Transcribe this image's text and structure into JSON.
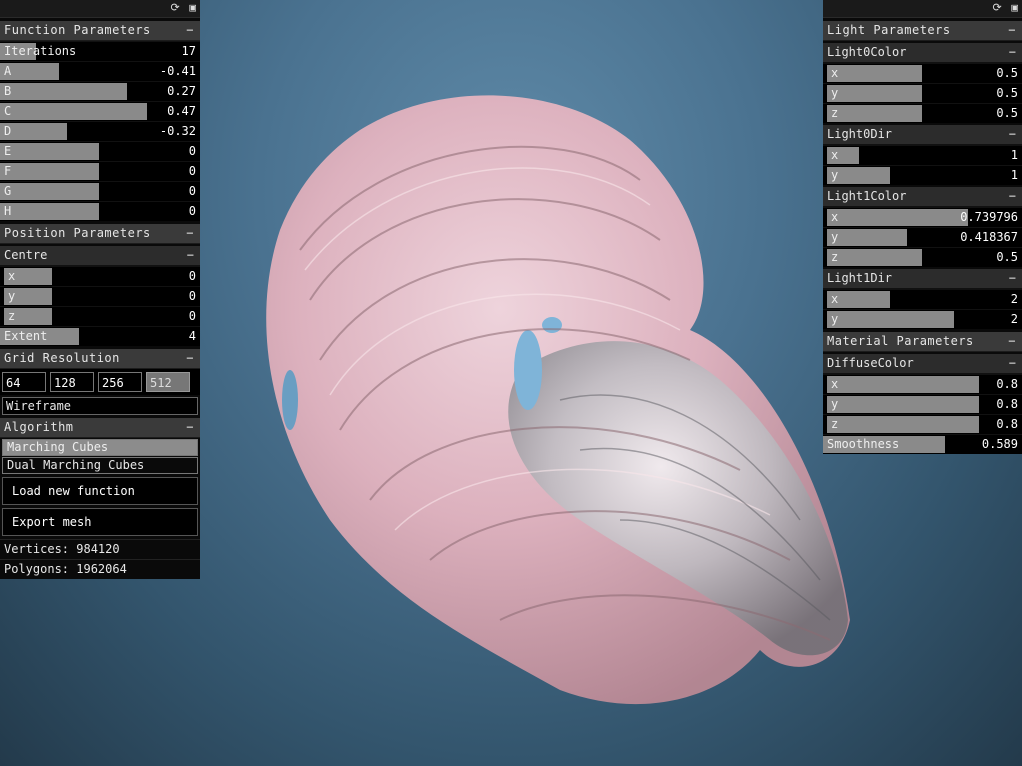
{
  "left_panel": {
    "function_params": {
      "title": "Function Parameters",
      "toggle": "−",
      "rows": [
        {
          "label": "Iterations",
          "value": "17",
          "fill": 0.18
        },
        {
          "label": "A",
          "value": "-0.41",
          "fill": 0.3
        },
        {
          "label": "B",
          "value": "0.27",
          "fill": 0.64
        },
        {
          "label": "C",
          "value": "0.47",
          "fill": 0.74
        },
        {
          "label": "D",
          "value": "-0.32",
          "fill": 0.34
        },
        {
          "label": "E",
          "value": "0",
          "fill": 0.5
        },
        {
          "label": "F",
          "value": "0",
          "fill": 0.5
        },
        {
          "label": "G",
          "value": "0",
          "fill": 0.5
        },
        {
          "label": "H",
          "value": "0",
          "fill": 0.5
        }
      ]
    },
    "position_params": {
      "title": "Position Parameters",
      "toggle": "−",
      "centre": {
        "title": "Centre",
        "toggle": "−",
        "rows": [
          {
            "label": "x",
            "value": "0",
            "fill": 0.5
          },
          {
            "label": "y",
            "value": "0",
            "fill": 0.5
          },
          {
            "label": "z",
            "value": "0",
            "fill": 0.5
          }
        ]
      },
      "extent": {
        "label": "Extent",
        "value": "4",
        "fill": 0.4
      }
    },
    "grid": {
      "title": "Grid Resolution",
      "toggle": "−",
      "options": [
        "64",
        "128",
        "256",
        "512"
      ],
      "selected": "512",
      "wireframe_label": "Wireframe"
    },
    "algorithm": {
      "title": "Algorithm",
      "toggle": "−",
      "options": [
        "Marching Cubes",
        "Dual Marching Cubes"
      ],
      "selected": "Marching Cubes"
    },
    "buttons": {
      "load": "Load new function",
      "export": "Export mesh"
    },
    "stats": {
      "vertices": "Vertices: 984120",
      "polygons": "Polygons: 1962064"
    }
  },
  "right_panel": {
    "light_params_title": "Light Parameters",
    "material_params_title": "Material Parameters",
    "toggle": "−",
    "light0color": {
      "title": "Light0Color",
      "rows": [
        {
          "label": "x",
          "value": "0.5",
          "fill": 0.5
        },
        {
          "label": "y",
          "value": "0.5",
          "fill": 0.5
        },
        {
          "label": "z",
          "value": "0.5",
          "fill": 0.5
        }
      ]
    },
    "light0dir": {
      "title": "Light0Dir",
      "rows": [
        {
          "label": "x",
          "value": "1",
          "fill": 0.17
        },
        {
          "label": "y",
          "value": "1",
          "fill": 0.33
        }
      ]
    },
    "light1color": {
      "title": "Light1Color",
      "rows": [
        {
          "label": "x",
          "value": "0.739796",
          "fill": 0.74
        },
        {
          "label": "y",
          "value": "0.418367",
          "fill": 0.42
        },
        {
          "label": "z",
          "value": "0.5",
          "fill": 0.5
        }
      ]
    },
    "light1dir": {
      "title": "Light1Dir",
      "rows": [
        {
          "label": "x",
          "value": "2",
          "fill": 0.33
        },
        {
          "label": "y",
          "value": "2",
          "fill": 0.67
        }
      ]
    },
    "diffusecolor": {
      "title": "DiffuseColor",
      "rows": [
        {
          "label": "x",
          "value": "0.8",
          "fill": 0.8
        },
        {
          "label": "y",
          "value": "0.8",
          "fill": 0.8
        },
        {
          "label": "z",
          "value": "0.8",
          "fill": 0.8
        }
      ]
    },
    "smoothness": {
      "label": "Smoothness",
      "value": "0.589",
      "fill": 0.62
    }
  },
  "icons": {
    "refresh": "refresh-icon",
    "save": "save-icon"
  },
  "colors": {
    "mesh_pink": "#e8b8c4",
    "mesh_silver": "#c8c8cc",
    "bg_center": "#5f8aa8",
    "bg_edge": "#233a4b"
  }
}
